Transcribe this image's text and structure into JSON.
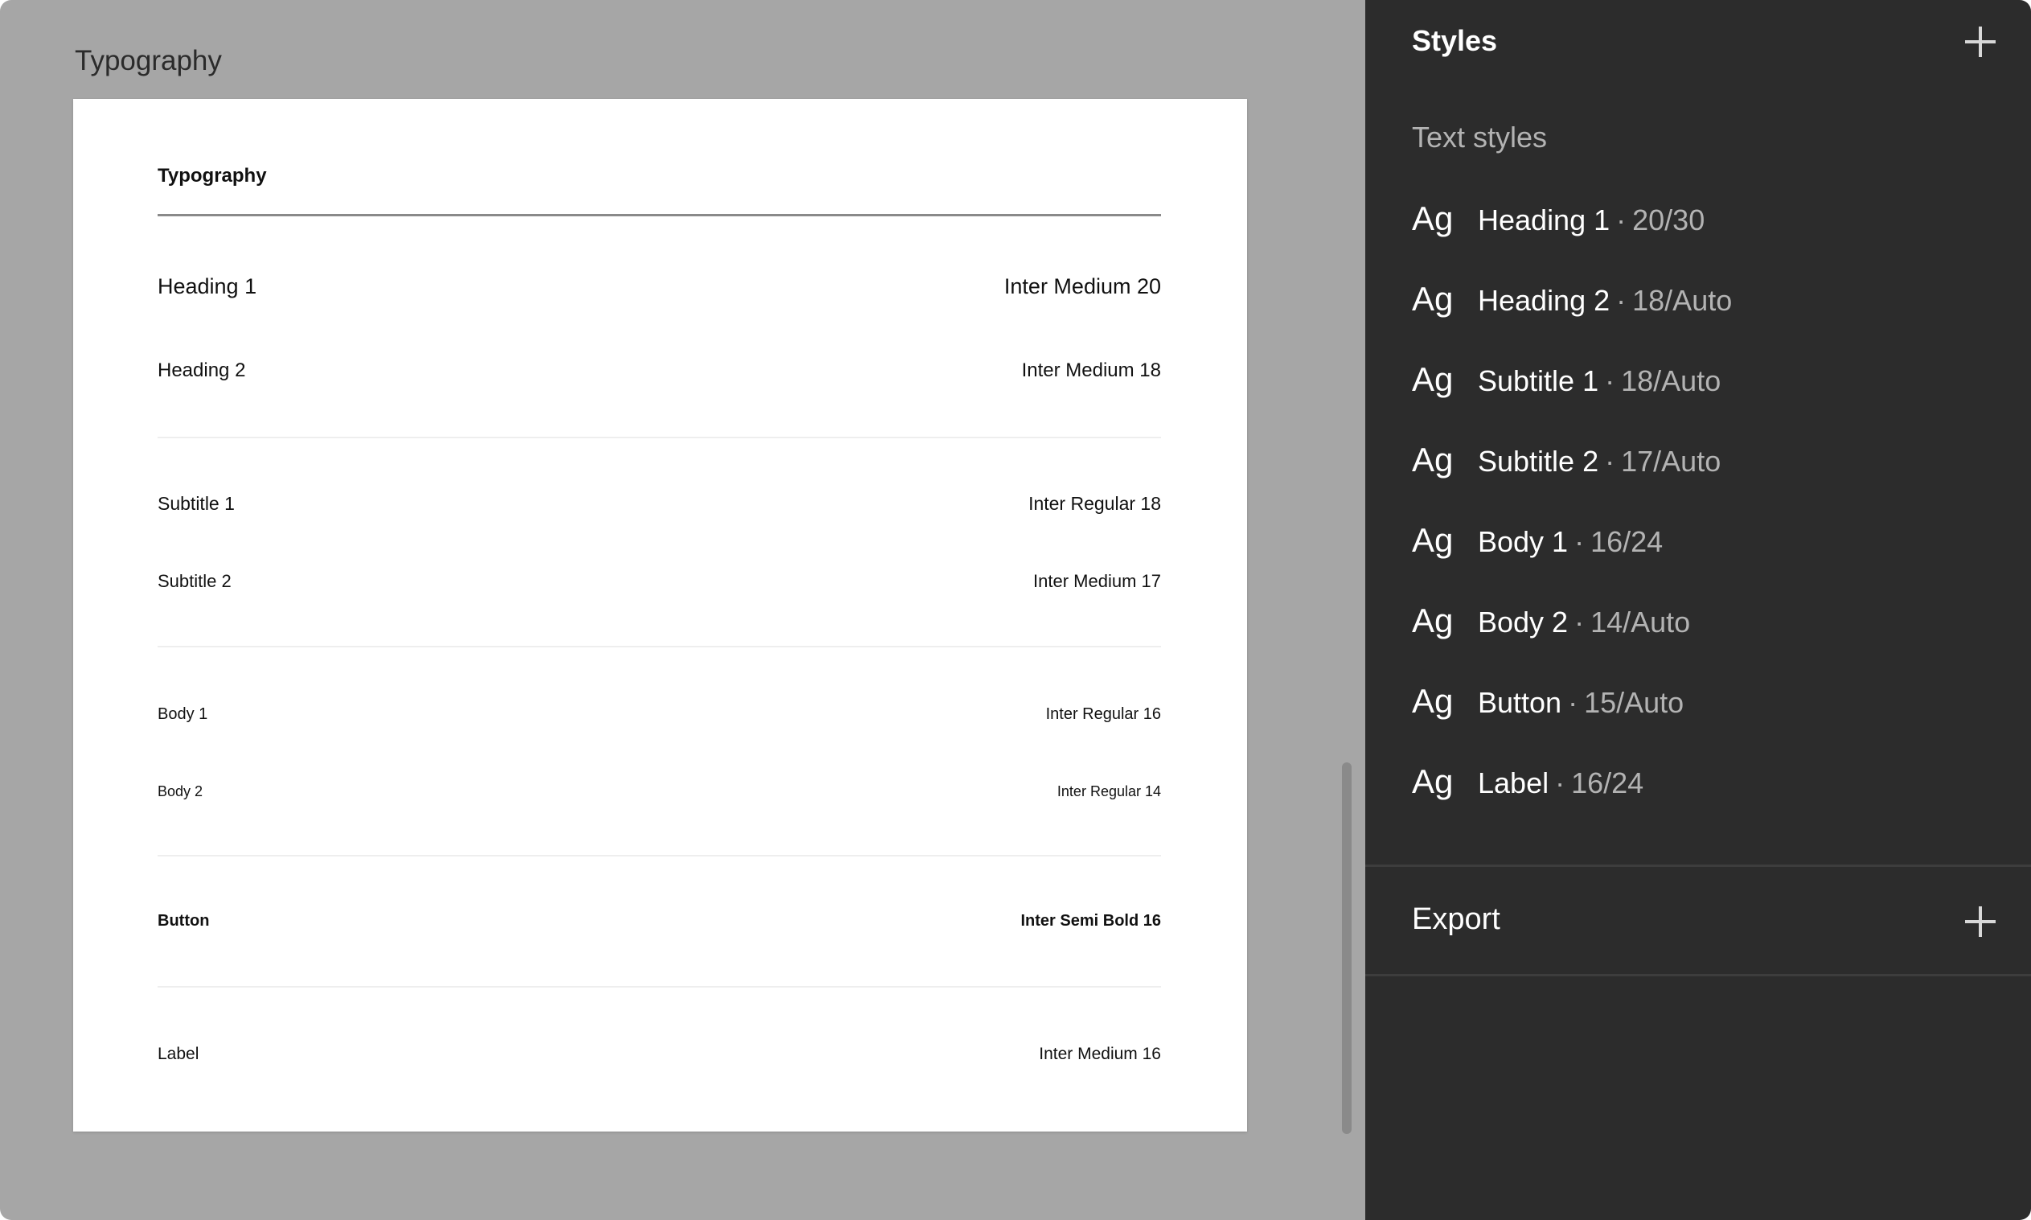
{
  "canvas": {
    "frame_label": "Typography",
    "frame": {
      "title": "Typography",
      "rows": [
        {
          "name": "Heading 1",
          "font": "Inter Medium 20"
        },
        {
          "name": "Heading 2",
          "font": "Inter Medium 18"
        },
        {
          "name": "Subtitle 1",
          "font": "Inter Regular 18"
        },
        {
          "name": "Subtitle 2",
          "font": "Inter Medium 17"
        },
        {
          "name": "Body 1",
          "font": "Inter Regular 16"
        },
        {
          "name": "Body 2",
          "font": "Inter Regular 14"
        },
        {
          "name": "Button",
          "font": "Inter Semi Bold 16"
        },
        {
          "name": "Label",
          "font": "Inter Medium 16"
        }
      ]
    }
  },
  "panel": {
    "header": "Styles",
    "text_styles_title": "Text styles",
    "ag_glyph": "Ag",
    "separator": "·",
    "styles": [
      {
        "name": "Heading 1",
        "meta": "20/30"
      },
      {
        "name": "Heading 2",
        "meta": "18/Auto"
      },
      {
        "name": "Subtitle 1",
        "meta": "18/Auto"
      },
      {
        "name": "Subtitle 2",
        "meta": "17/Auto"
      },
      {
        "name": "Body 1",
        "meta": "16/24"
      },
      {
        "name": "Body 2",
        "meta": "14/Auto"
      },
      {
        "name": "Button",
        "meta": "15/Auto"
      },
      {
        "name": "Label",
        "meta": "16/24"
      }
    ],
    "export_title": "Export",
    "icons": {
      "add_style": "plus-icon",
      "add_export": "plus-icon"
    }
  }
}
